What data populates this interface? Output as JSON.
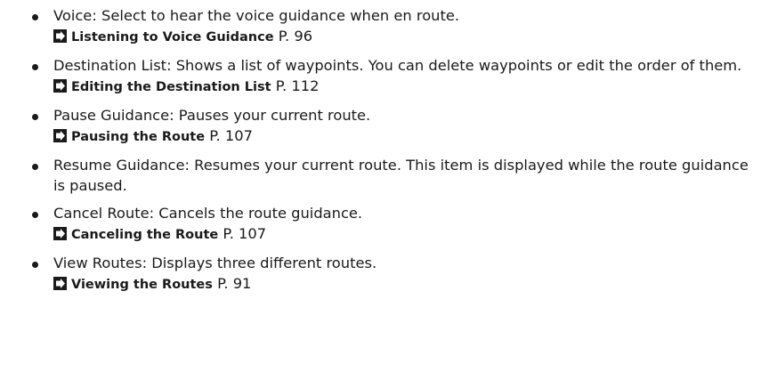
{
  "items": [
    {
      "term": "Voice",
      "desc": ": Select to hear the voice guidance when en route.",
      "ref": {
        "title": "Listening to Voice Guidance",
        "page": "P. 96"
      }
    },
    {
      "term": "Destination List",
      "desc": ": Shows a list of waypoints. You can delete waypoints or edit the order of them.",
      "ref": {
        "title": "Editing the Destination List",
        "page": "P. 112"
      }
    },
    {
      "term": "Pause Guidance",
      "desc": ": Pauses your current route.",
      "ref": {
        "title": "Pausing the Route",
        "page": "P. 107"
      }
    },
    {
      "term": "Resume Guidance",
      "desc": ": Resumes your current route. This item is displayed while the route guidance is paused."
    },
    {
      "term": "Cancel Route",
      "desc": ": Cancels the route guidance.",
      "ref": {
        "title": "Canceling the Route",
        "page": "P. 107"
      }
    },
    {
      "term": "View Routes",
      "desc": ": Displays three different routes.",
      "ref": {
        "title": "Viewing the Routes",
        "page": "P. 91"
      }
    }
  ]
}
